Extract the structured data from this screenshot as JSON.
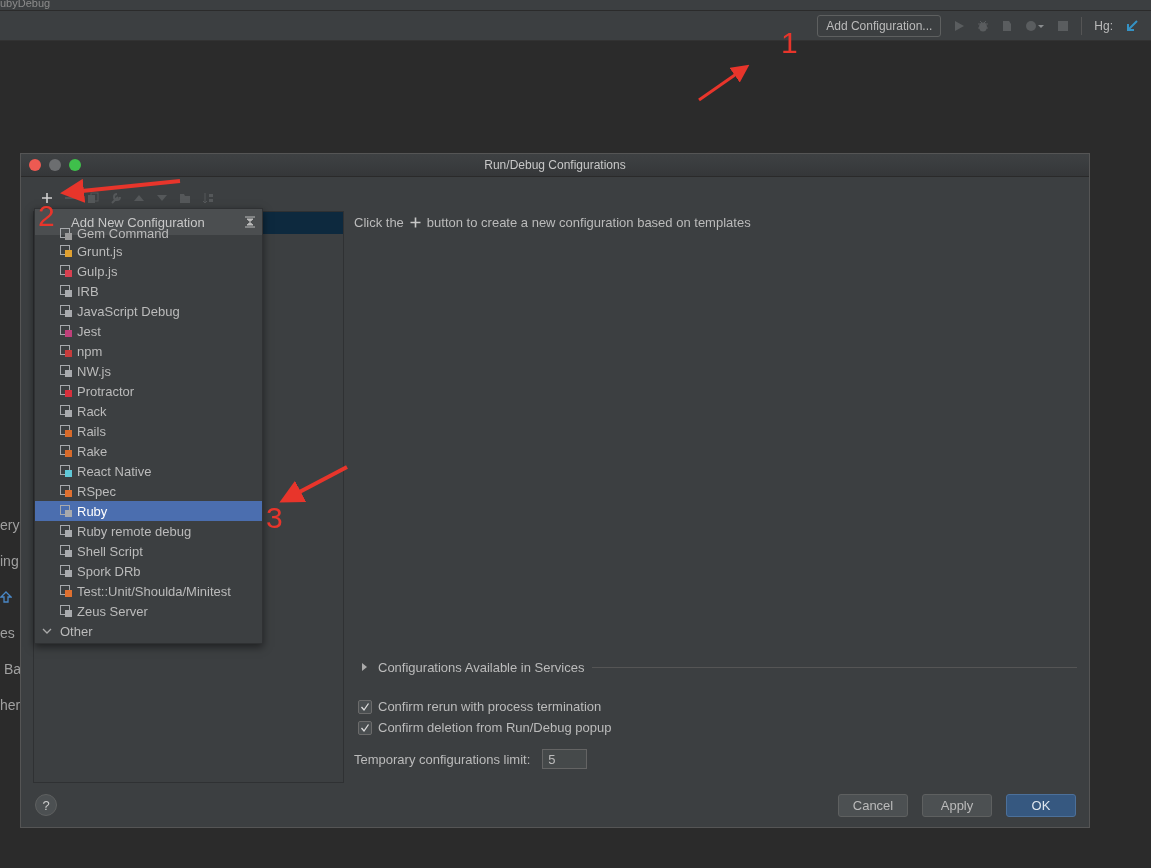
{
  "window": {
    "title": "ubyDebug"
  },
  "toolbar": {
    "config_button": "Add Configuration...",
    "vcs_label": "Hg:"
  },
  "background_fragments": [
    "ery",
    "ing",
    "es",
    "Ba",
    "her"
  ],
  "dialog": {
    "title": "Run/Debug Configurations",
    "toolbar_buttons": [
      {
        "kind": "add",
        "disabled": false
      },
      {
        "kind": "remove",
        "disabled": true
      },
      {
        "kind": "copy",
        "disabled": true
      },
      {
        "kind": "edit",
        "disabled": true
      },
      {
        "kind": "up",
        "disabled": true
      },
      {
        "kind": "down",
        "disabled": true
      },
      {
        "kind": "folder",
        "disabled": true
      },
      {
        "kind": "sort",
        "disabled": true
      }
    ],
    "popup": {
      "title": "Add New Configuration",
      "items": [
        {
          "label": "Gem Command",
          "selected": false
        },
        {
          "label": "Grunt.js",
          "selected": false
        },
        {
          "label": "Gulp.js",
          "selected": false
        },
        {
          "label": "IRB",
          "selected": false
        },
        {
          "label": "JavaScript Debug",
          "selected": false
        },
        {
          "label": "Jest",
          "selected": false
        },
        {
          "label": "npm",
          "selected": false
        },
        {
          "label": "NW.js",
          "selected": false
        },
        {
          "label": "Protractor",
          "selected": false
        },
        {
          "label": "Rack",
          "selected": false
        },
        {
          "label": "Rails",
          "selected": false
        },
        {
          "label": "Rake",
          "selected": false
        },
        {
          "label": "React Native",
          "selected": false
        },
        {
          "label": "RSpec",
          "selected": false
        },
        {
          "label": "Ruby",
          "selected": true
        },
        {
          "label": "Ruby remote debug",
          "selected": false
        },
        {
          "label": "Shell Script",
          "selected": false
        },
        {
          "label": "Spork DRb",
          "selected": false
        },
        {
          "label": "Test::Unit/Shoulda/Minitest",
          "selected": false
        },
        {
          "label": "Zeus Server",
          "selected": false
        }
      ],
      "group": {
        "label": "Other",
        "expanded": true
      }
    },
    "hint_before": "Click the",
    "hint_after": "button to create a new configuration based on templates",
    "services": {
      "label": "Configurations Available in Services",
      "expanded": false
    },
    "options": [
      {
        "label": "Confirm rerun with process termination",
        "checked": true
      },
      {
        "label": "Confirm deletion from Run/Debug popup",
        "checked": true
      }
    ],
    "limit": {
      "label": "Temporary configurations limit:",
      "value": "5"
    },
    "help": "?",
    "buttons": [
      {
        "label": "Cancel",
        "default": false
      },
      {
        "label": "Apply",
        "default": false
      },
      {
        "label": "OK",
        "default": true
      }
    ]
  },
  "annotations": [
    "1",
    "2",
    "3"
  ]
}
